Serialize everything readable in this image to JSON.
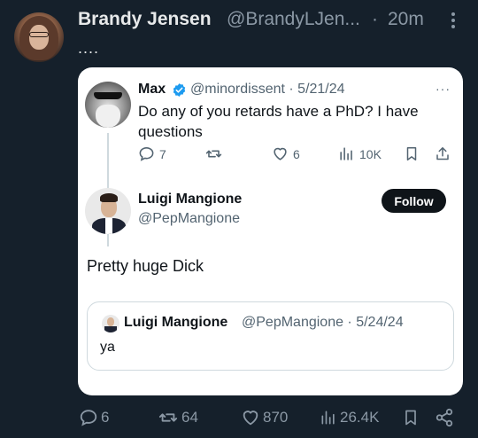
{
  "post": {
    "author_name": "Brandy Jensen",
    "author_handle": "@BrandyLJen...",
    "separator": "·",
    "time": "20m",
    "text": "....",
    "stats": {
      "replies": "6",
      "reposts": "64",
      "likes": "870",
      "views": "26.4K"
    }
  },
  "card": {
    "original": {
      "author_name": "Max",
      "author_handle_time": "@minordissent · 5/21/24",
      "more_label": "···",
      "text": "Do any of you retards have a PhD? I have questions",
      "stats": {
        "replies": "7",
        "reposts": "",
        "likes": "6",
        "views": "10K"
      }
    },
    "reply": {
      "author_name": "Luigi Mangione",
      "author_handle": "@PepMangione",
      "follow_label": "Follow",
      "text": "Pretty huge Dick",
      "quote": {
        "author_name": "Luigi Mangione",
        "author_handle_time": "@PepMangione · 5/24/24",
        "text": "ya"
      }
    }
  },
  "colors": {
    "background": "#15202b",
    "verified": "#1d9bf0",
    "follow_button": "#0f1419"
  }
}
